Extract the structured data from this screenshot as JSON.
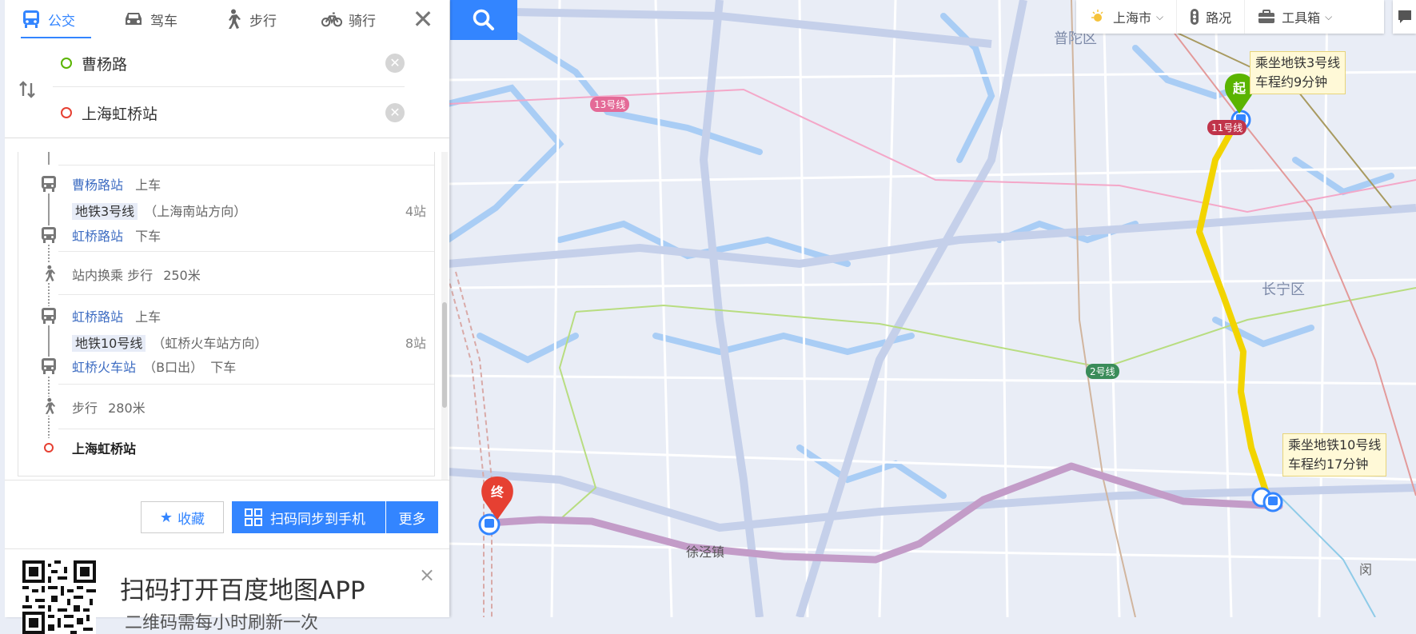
{
  "tabs": [
    {
      "label": "公交",
      "icon": "bus-icon",
      "active": true
    },
    {
      "label": "驾车",
      "icon": "car-icon",
      "active": false
    },
    {
      "label": "步行",
      "icon": "walk-icon",
      "active": false
    },
    {
      "label": "骑行",
      "icon": "bicycle-icon",
      "active": false
    }
  ],
  "route": {
    "origin": "曹杨路",
    "destination": "上海虹桥站"
  },
  "steps": {
    "board1_station": "曹杨路站",
    "board1_action": "上车",
    "line1_name": "地铁3号线",
    "line1_direction": "（上海南站方向）",
    "line1_count": "4站",
    "alight1_station": "虹桥路站",
    "alight1_action": "下车",
    "transfer_text": "站内换乘 步行",
    "transfer_distance": "250米",
    "board2_station": "虹桥路站",
    "board2_action": "上车",
    "line2_name": "地铁10号线",
    "line2_direction": "（虹桥火车站方向）",
    "line2_count": "8站",
    "alight2_station": "虹桥火车站",
    "alight2_exit": "（B口出）",
    "alight2_action": "下车",
    "walk_text": "步行",
    "walk_distance": "280米",
    "final_destination": "上海虹桥站"
  },
  "actions": {
    "favorite_label": "收藏",
    "sync_label": "扫码同步到手机",
    "more_label": "更多"
  },
  "promo": {
    "title": "扫码打开百度地图APP",
    "subtitle": "二维码需每小时刷新一次",
    "close": "×"
  },
  "topbar": {
    "city": "上海市",
    "traffic": "路况",
    "toolbox": "工具箱"
  },
  "map": {
    "district_putuo": "普陀区",
    "district_changning": "长宁区",
    "road_label": "徐泾镇",
    "line13_tag": "13号线",
    "line11_tag": "11号线",
    "line2_tag": "2号线",
    "start_marker": "起",
    "end_marker": "终",
    "tip1_line1": "乘坐地铁3号线",
    "tip1_line2": "车程约9分钟",
    "tip2_line1": "乘坐地铁10号线",
    "tip2_line2": "车程约17分钟",
    "edge_text": "闵"
  },
  "colors": {
    "accent": "#3385ff",
    "line3": "#f2d400",
    "line10": "#c39cc8",
    "start_green": "#5ab400",
    "end_red": "#e64032"
  }
}
